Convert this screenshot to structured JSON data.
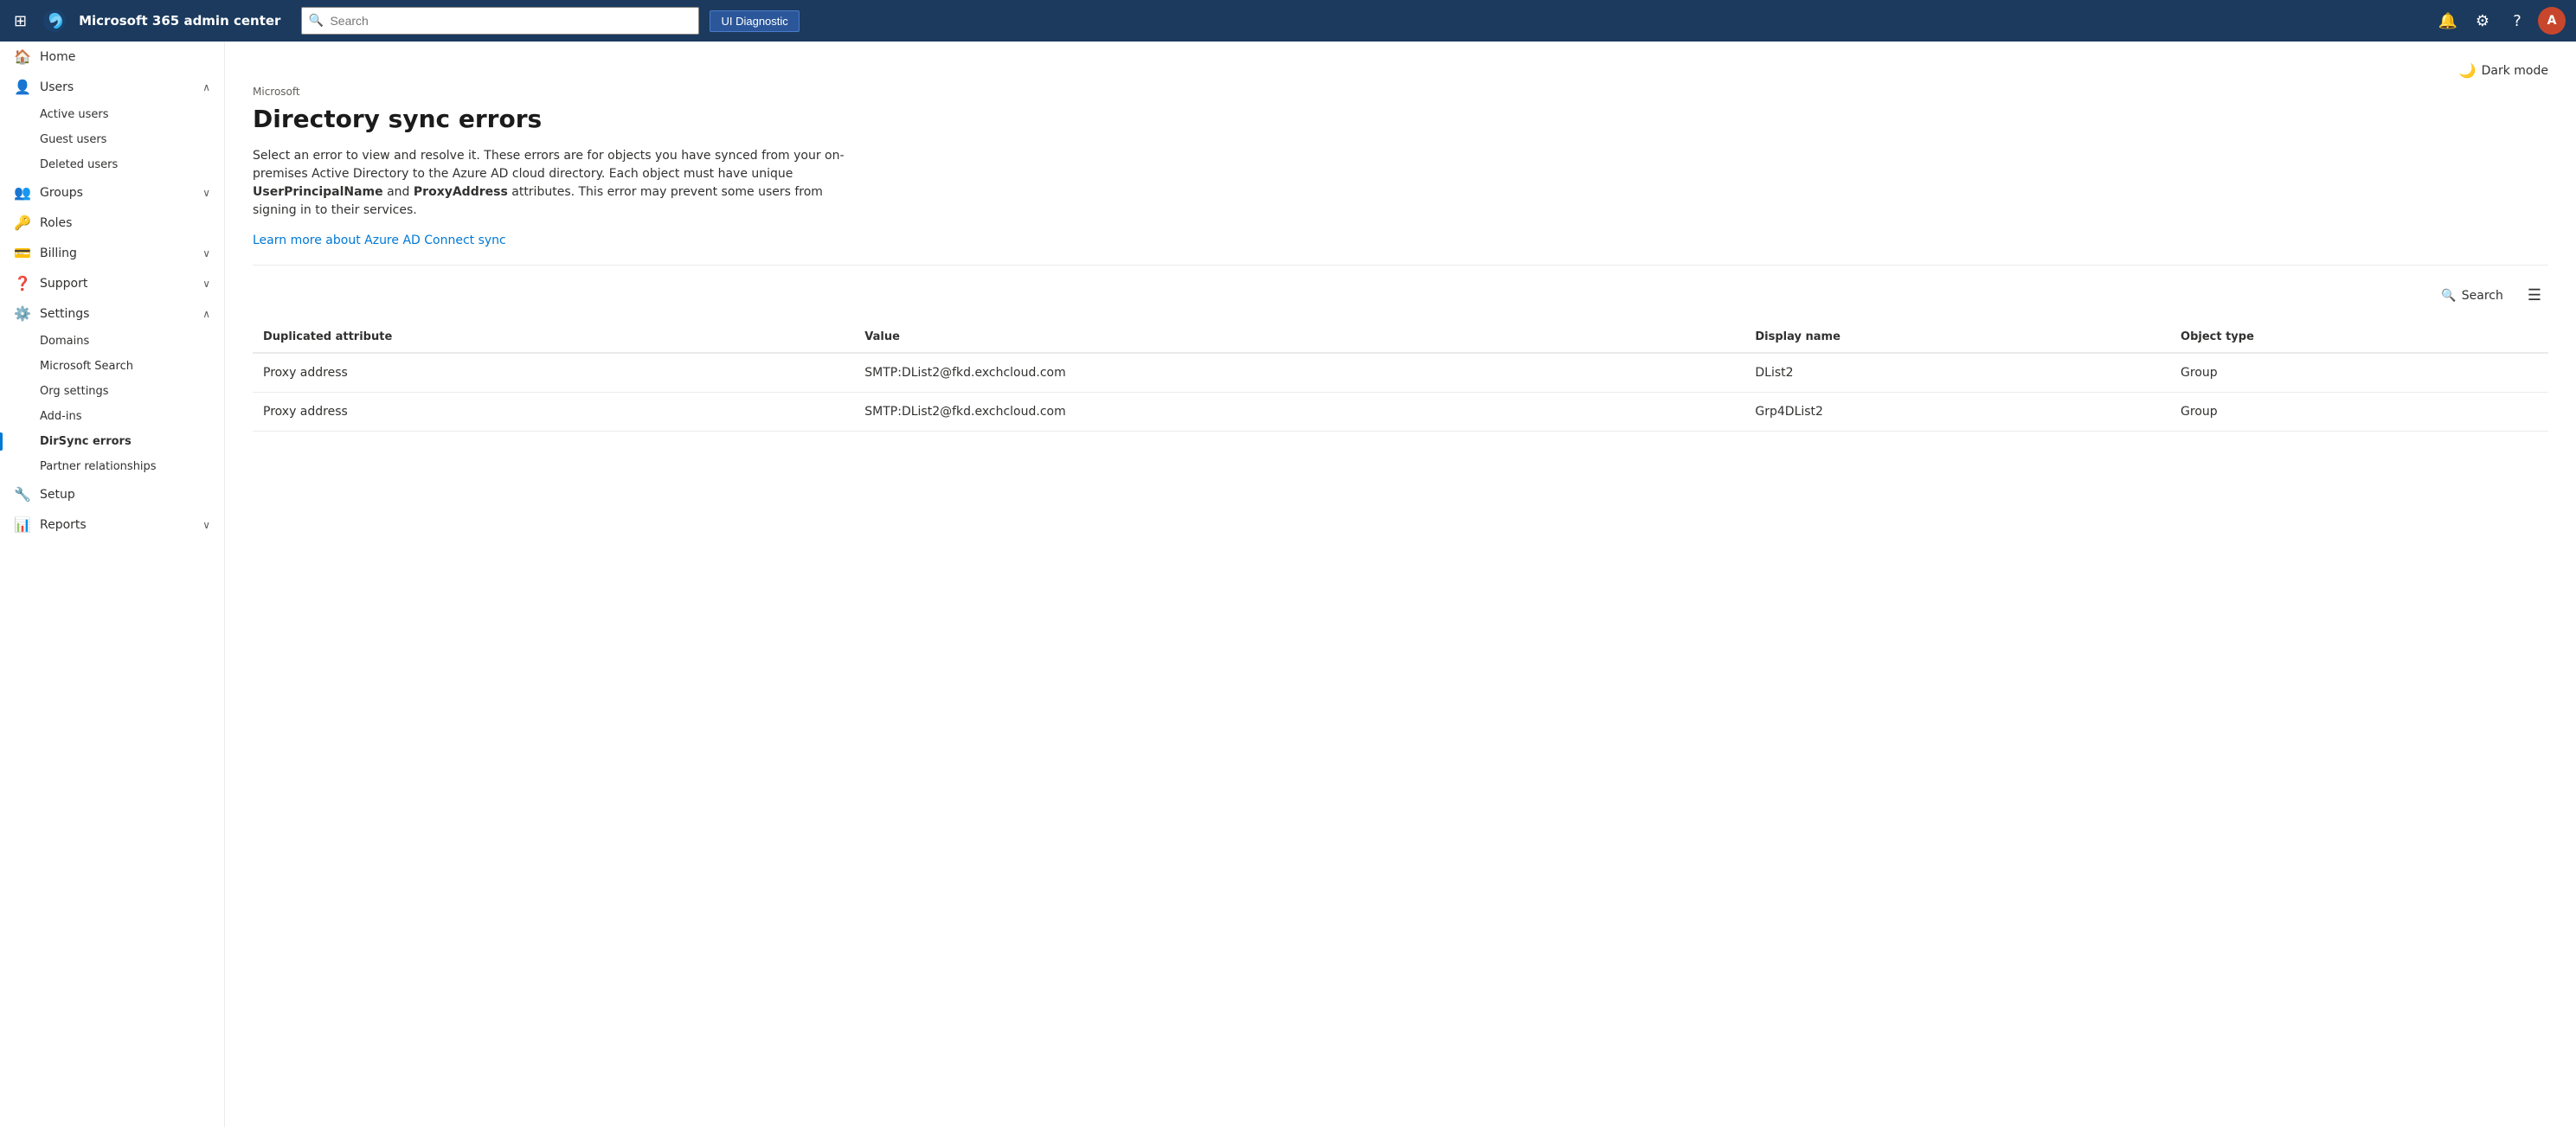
{
  "topbar": {
    "title": "Microsoft 365 admin center",
    "search_placeholder": "Search",
    "ui_diagnostic_label": "UI Diagnostic",
    "avatar_initials": "A"
  },
  "sidebar": {
    "sections": [
      {
        "id": "home",
        "label": "Home",
        "icon": "🏠",
        "expandable": false,
        "active": false
      },
      {
        "id": "users",
        "label": "Users",
        "icon": "👤",
        "expandable": true,
        "expanded": true,
        "active": false
      },
      {
        "id": "groups",
        "label": "Groups",
        "icon": "👥",
        "expandable": true,
        "expanded": false,
        "active": false
      },
      {
        "id": "roles",
        "label": "Roles",
        "icon": "🔑",
        "expandable": false,
        "active": false
      },
      {
        "id": "billing",
        "label": "Billing",
        "icon": "💳",
        "expandable": true,
        "expanded": false,
        "active": false
      },
      {
        "id": "support",
        "label": "Support",
        "icon": "❓",
        "expandable": true,
        "expanded": false,
        "active": false
      },
      {
        "id": "settings",
        "label": "Settings",
        "icon": "⚙️",
        "expandable": true,
        "expanded": true,
        "active": false
      },
      {
        "id": "setup",
        "label": "Setup",
        "icon": "🔧",
        "expandable": false,
        "active": false
      },
      {
        "id": "reports",
        "label": "Reports",
        "icon": "📊",
        "expandable": true,
        "expanded": false,
        "active": false
      }
    ],
    "users_sub": [
      {
        "id": "active-users",
        "label": "Active users"
      },
      {
        "id": "guest-users",
        "label": "Guest users"
      },
      {
        "id": "deleted-users",
        "label": "Deleted users"
      }
    ],
    "settings_sub": [
      {
        "id": "domains",
        "label": "Domains"
      },
      {
        "id": "microsoft-search",
        "label": "Microsoft Search"
      },
      {
        "id": "org-settings",
        "label": "Org settings"
      },
      {
        "id": "add-ins",
        "label": "Add-ins"
      },
      {
        "id": "dirsync-errors",
        "label": "DirSync errors",
        "active": true
      },
      {
        "id": "partner-relationships",
        "label": "Partner relationships"
      }
    ]
  },
  "page": {
    "breadcrumb": "Microsoft",
    "title": "Directory sync errors",
    "description_part1": "Select an error to view and resolve it. These errors are for objects you have synced from your on-premises Active Directory to the Azure AD cloud directory. Each object must have unique ",
    "description_bold1": "UserPrincipalName",
    "description_and": " and ",
    "description_bold2": "ProxyAddress",
    "description_part2": " attributes. This error may prevent some users from signing in to their services.",
    "learn_more_text": "Learn more about Azure AD Connect sync",
    "dark_mode_label": "Dark mode"
  },
  "toolbar": {
    "search_label": "Search",
    "filter_icon": "☰"
  },
  "table": {
    "columns": [
      "Duplicated attribute",
      "Value",
      "Display name",
      "Object type"
    ],
    "rows": [
      {
        "duplicated_attribute": "Proxy address",
        "value": "SMTP:DList2@fkd.exchcloud.com",
        "display_name": "DList2",
        "object_type": "Group"
      },
      {
        "duplicated_attribute": "Proxy address",
        "value": "SMTP:DList2@fkd.exchcloud.com",
        "display_name": "Grp4DList2",
        "object_type": "Group"
      }
    ]
  }
}
